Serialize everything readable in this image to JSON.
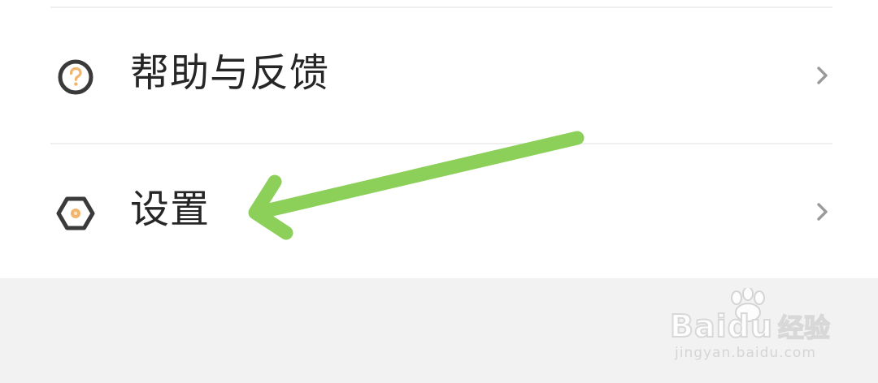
{
  "menu": {
    "items": [
      {
        "label": "帮助与反馈",
        "icon": "help-icon",
        "icon_color": "#f2b56b"
      },
      {
        "label": "设置",
        "icon": "settings-icon",
        "icon_color": "#f2b56b"
      }
    ]
  },
  "overlay": {
    "arrow_color": "#8cd05a"
  },
  "watermark": {
    "brand_latin": "Bai",
    "brand_latin_2": "du",
    "brand_cn": "经验",
    "url": "jingyan.baidu.com"
  },
  "colors": {
    "background": "#f2f2f2",
    "card": "#ffffff",
    "text": "#262626",
    "chevron": "#9a9a9a",
    "icon_outline": "#3a3a3a"
  }
}
